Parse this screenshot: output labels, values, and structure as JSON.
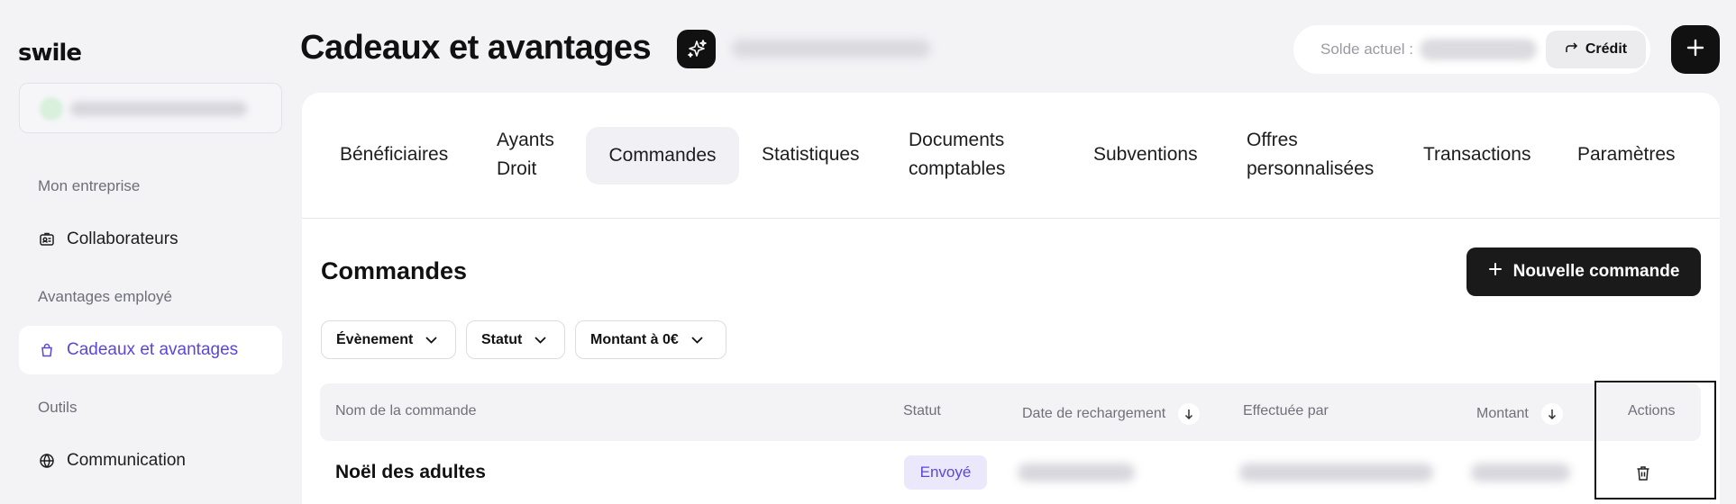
{
  "app": {
    "logo": "swile"
  },
  "sidebar": {
    "section_company": "Mon entreprise",
    "item_collaborators": "Collaborateurs",
    "section_benefits": "Avantages employé",
    "item_gifts": "Cadeaux et avantages",
    "section_tools": "Outils",
    "item_communication": "Communication"
  },
  "header": {
    "title": "Cadeaux et avantages",
    "balance_label": "Solde actuel :",
    "credit_label": "Crédit"
  },
  "tabs": [
    {
      "label": "Bénéficiaires"
    },
    {
      "label": "Ayants Droit"
    },
    {
      "label": "Commandes"
    },
    {
      "label": "Statistiques"
    },
    {
      "label": "Documents comptables"
    },
    {
      "label": "Subventions"
    },
    {
      "label": "Offres personnalisées"
    },
    {
      "label": "Transactions"
    },
    {
      "label": "Paramètres"
    }
  ],
  "orders": {
    "title": "Commandes",
    "new_order_label": "Nouvelle commande",
    "filters": [
      "Évènement",
      "Statut",
      "Montant à 0€"
    ],
    "columns": {
      "name": "Nom de la commande",
      "status": "Statut",
      "date": "Date de rechargement",
      "by": "Effectuée par",
      "amount": "Montant",
      "actions": "Actions"
    },
    "rows": [
      {
        "name": "Noël des adultes",
        "status": "Envoyé"
      }
    ]
  },
  "colors": {
    "accent": "#5b47d6",
    "badge_bg": "#ece8fb",
    "dark": "#111111"
  }
}
